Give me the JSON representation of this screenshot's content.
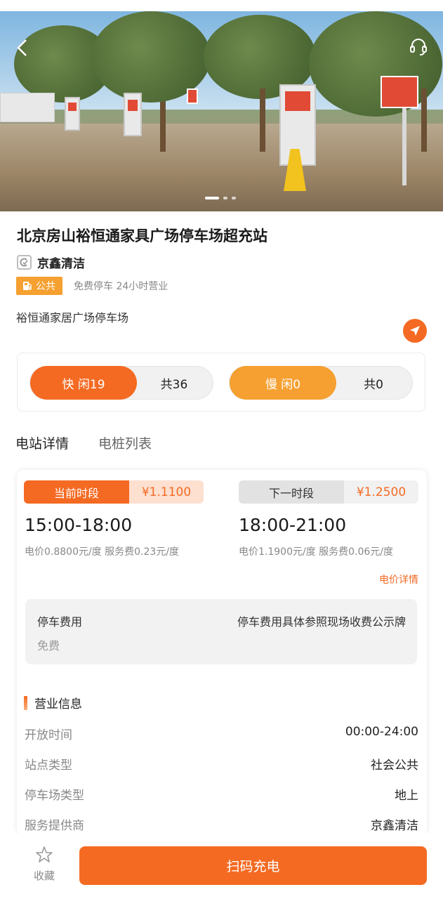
{
  "hero": {
    "back_icon": "chevron-left-icon",
    "service_icon": "headset-icon",
    "carousel_count": 3,
    "carousel_active": 1
  },
  "station": {
    "name": "北京房山裕恒通家具广场停车场超充站",
    "operator": "京鑫清洁",
    "tag_public": "公共",
    "tag_info": "免费停车 24小时营业",
    "address": "裕恒通家居广场停车场"
  },
  "availability": {
    "fast": {
      "idle_label": "快 闲19",
      "total_label": "共36"
    },
    "slow": {
      "idle_label": "慢 闲0",
      "total_label": "共0"
    }
  },
  "tabs": [
    {
      "label": "电站详情",
      "active": true
    },
    {
      "label": "电桩列表",
      "active": false
    }
  ],
  "pricing": {
    "current": {
      "label": "当前时段",
      "price": "¥1.1100",
      "time": "15:00-18:00",
      "breakdown": "电价0.8800元/度 服务费0.23元/度"
    },
    "next": {
      "label": "下一时段",
      "price": "¥1.2500",
      "time": "18:00-21:00",
      "breakdown": "电价1.1900元/度 服务费0.06元/度"
    },
    "detail_link": "电价详情"
  },
  "parking": {
    "label": "停车费用",
    "note": "停车费用具体参照现场收费公示牌",
    "value": "免费"
  },
  "business": {
    "heading": "营业信息",
    "rows": [
      {
        "key": "开放时间",
        "value": "00:00-24:00"
      },
      {
        "key": "站点类型",
        "value": "社会公共"
      },
      {
        "key": "停车场类型",
        "value": "地上"
      },
      {
        "key": "服务提供商",
        "value": "京鑫清洁"
      }
    ]
  },
  "bottom": {
    "favorite_label": "收藏",
    "scan_label": "扫码充电"
  },
  "colors": {
    "accent": "#f46a22",
    "slow_accent": "#f5a030",
    "public_tag": "#f5a030",
    "period_current_bg": "#f46a22",
    "period_current_price_bg": "#fde0d0",
    "period_next_bg": "#e2e2e2",
    "period_next_price_bg": "#f1f1f1"
  }
}
